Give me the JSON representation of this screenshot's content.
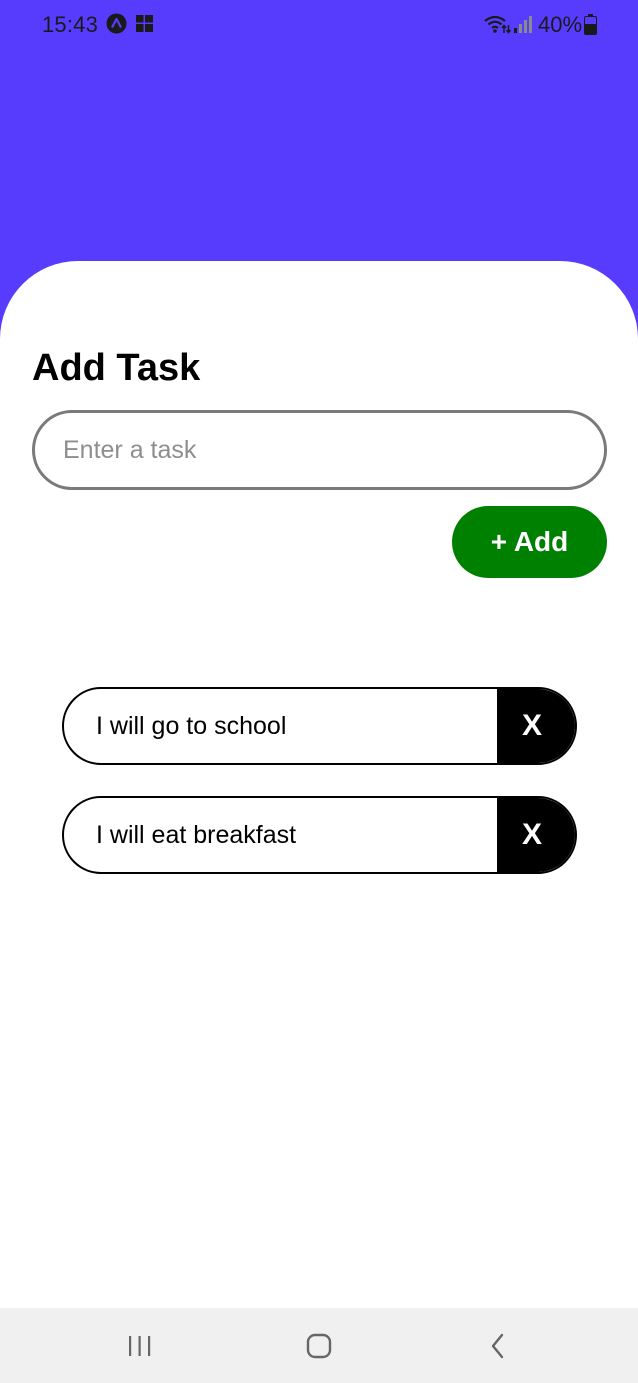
{
  "status_bar": {
    "time": "15:43",
    "battery": "40%",
    "icons": [
      "expo-icon",
      "app-icon",
      "wifi-icon",
      "signal-icon",
      "battery-icon"
    ]
  },
  "colors": {
    "header": "#583cfd",
    "add_button": "#008000",
    "delete_button": "#000000",
    "nav_bar": "#f0f0f0"
  },
  "screen": {
    "title": "Add Task",
    "input": {
      "placeholder": "Enter a task",
      "value": ""
    },
    "add_button_label": "+ Add"
  },
  "tasks": [
    {
      "text": "I will go to school",
      "delete_label": "X"
    },
    {
      "text": "I will eat breakfast",
      "delete_label": "X"
    }
  ],
  "nav_bar": {
    "buttons": [
      "recents-icon",
      "home-icon",
      "back-icon"
    ]
  }
}
